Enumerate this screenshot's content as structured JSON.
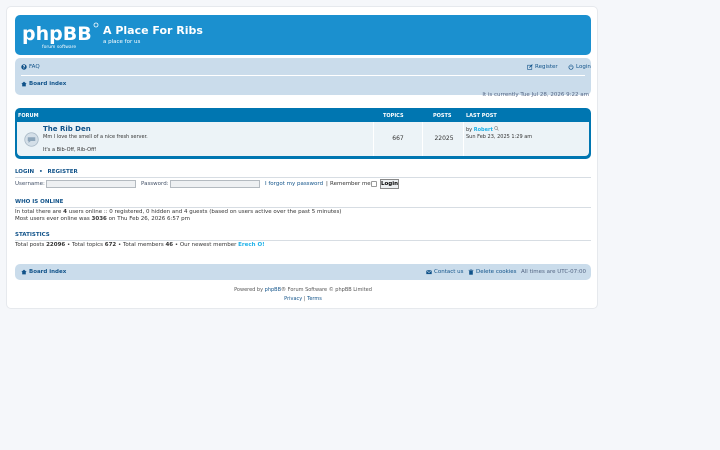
{
  "header": {
    "site_title": "A Place For Ribs",
    "site_description": "a place for us",
    "logo_text": "phpBB",
    "logo_subtext": "forum software"
  },
  "navbar": {
    "faq_label": "FAQ",
    "register_label": "Register",
    "login_label": "Login",
    "board_index_label": "Board index"
  },
  "current_time": "It is currently Tue Jul 28, 2026 9:22 am",
  "forum_table": {
    "headers": {
      "forum": "FORUM",
      "topics": "TOPICS",
      "posts": "POSTS",
      "last_post": "LAST POST"
    },
    "rows": [
      {
        "title": "The Rib Den",
        "description": "Mm I love the smell of a nice fresh server.",
        "subdescription": "It's a Bib-Off, Rib-Off!",
        "topics": "667",
        "posts": "22025",
        "last_post_by": "by",
        "last_post_author": "Robert",
        "last_post_date": "Sun Feb 23, 2025 1:29 am"
      }
    ]
  },
  "login_section": {
    "login_link": "LOGIN",
    "separator": "•",
    "register_link": "REGISTER",
    "username_label": "Username:",
    "password_label": "Password:",
    "forgot_password": "I forgot my password",
    "pipe": "|",
    "remember_me": "Remember me",
    "login_button": "Login"
  },
  "who_is_online": {
    "heading": "WHO IS ONLINE",
    "line1_prefix": "In total there are",
    "line1_count": "4",
    "line1_suffix": "users online :: 0 registered, 0 hidden and 4 guests (based on users active over the past 5 minutes)",
    "line2_prefix": "Most users ever online was",
    "line2_count": "3036",
    "line2_suffix": "on Thu Feb 26, 2026 6:57 pm"
  },
  "statistics": {
    "heading": "STATISTICS",
    "total_posts_label": "Total posts",
    "total_posts": "22096",
    "total_topics_label": "• Total topics",
    "total_topics": "672",
    "total_members_label": "• Total members",
    "total_members": "46",
    "newest_label": "• Our newest member",
    "newest_member": "Erech O!"
  },
  "footer": {
    "board_index_label": "Board index",
    "contact_label": "Contact us",
    "delete_cookies_label": "Delete cookies",
    "timezone_label": "All times are",
    "timezone_value": "UTC-07:00",
    "powered_prefix": "Powered by",
    "powered_link": "phpBB",
    "powered_suffix": "® Forum Software © phpBB Limited",
    "privacy_label": "Privacy",
    "pipe": "|",
    "terms_label": "Terms"
  },
  "colors": {
    "header_blue": "#1b90cf",
    "nav_bg": "#cadceb",
    "forum_header_blue": "#0076b1",
    "row_bg": "#ecf3f7",
    "link": "#105289",
    "username_highlight": "#1cb0e8"
  }
}
